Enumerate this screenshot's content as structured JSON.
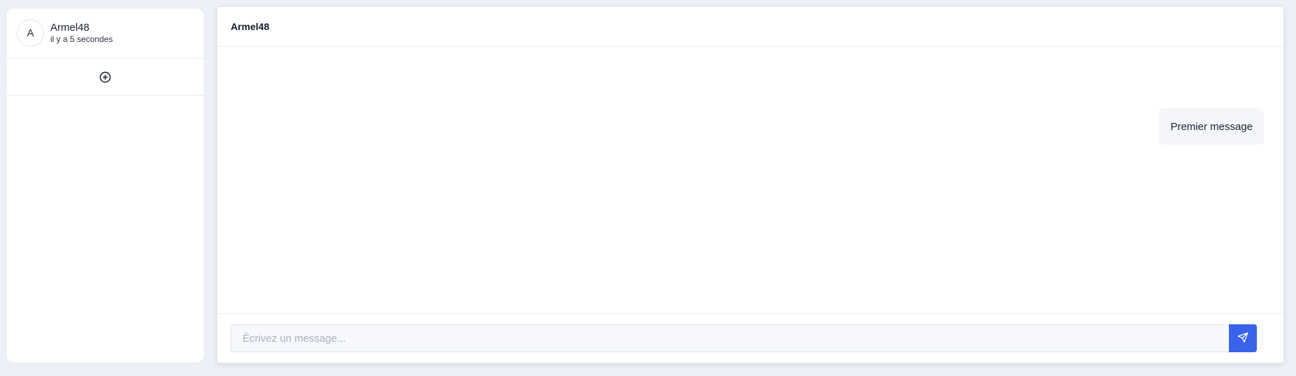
{
  "sidebar": {
    "conversations": [
      {
        "avatar_initial": "A",
        "name": "Armel48",
        "time": "il y a 5 secondes"
      }
    ],
    "new_conversation_icon": "plus-circle-icon"
  },
  "chat": {
    "title": "Armel48",
    "messages": [
      {
        "text": "Premier message",
        "side": "right"
      }
    ]
  },
  "composer": {
    "placeholder": "Écrivez un message...",
    "value": "",
    "send_icon": "send-icon"
  },
  "colors": {
    "background": "#edf0f6",
    "accent": "#3a63ec",
    "bubble": "#f4f6fa"
  }
}
